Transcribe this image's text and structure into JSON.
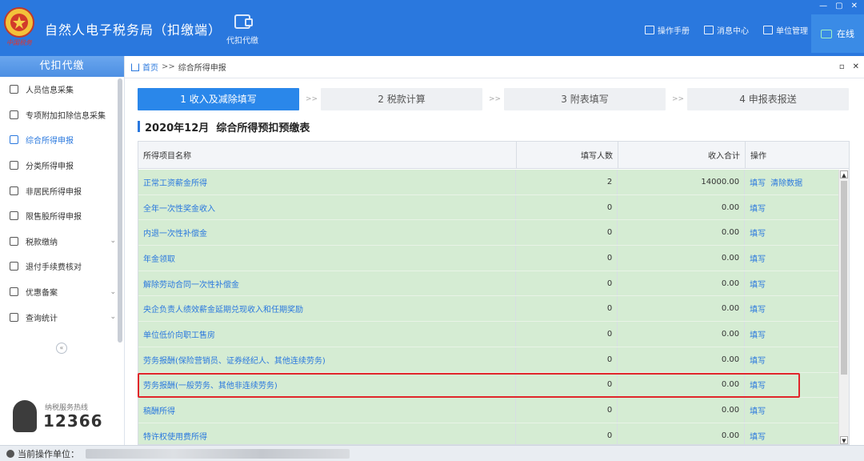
{
  "app": {
    "title": "自然人电子税务局（扣缴端）",
    "logo_text": "中国税务",
    "module_label": "代扣代缴"
  },
  "header": {
    "links": [
      "操作手册",
      "消息中心",
      "单位管理"
    ],
    "status": "在线",
    "window_controls": [
      "—",
      "▢",
      "✕"
    ]
  },
  "sidebar": {
    "title": "代扣代缴",
    "items": [
      {
        "label": "人员信息采集",
        "icon": "person-icon",
        "active": false,
        "expandable": false
      },
      {
        "label": "专项附加扣除信息采集",
        "icon": "list-icon",
        "active": false,
        "expandable": false
      },
      {
        "label": "综合所得申报",
        "icon": "layers-icon",
        "active": true,
        "expandable": false
      },
      {
        "label": "分类所得申报",
        "icon": "pie-chart-icon",
        "active": false,
        "expandable": false
      },
      {
        "label": "非居民所得申报",
        "icon": "person-outline-icon",
        "active": false,
        "expandable": false
      },
      {
        "label": "限售股所得申报",
        "icon": "bar-chart-icon",
        "active": false,
        "expandable": false
      },
      {
        "label": "税款缴纳",
        "icon": "folder-icon",
        "active": false,
        "expandable": true
      },
      {
        "label": "退付手续费核对",
        "icon": "document-icon",
        "active": false,
        "expandable": false
      },
      {
        "label": "优惠备案",
        "icon": "file-icon",
        "active": false,
        "expandable": true
      },
      {
        "label": "查询统计",
        "icon": "search-list-icon",
        "active": false,
        "expandable": true
      }
    ],
    "hotline_label": "纳税服务热线",
    "hotline_number": "12366"
  },
  "breadcrumb": {
    "home": "首页",
    "separator": ">>",
    "current": "综合所得申报"
  },
  "steps": [
    {
      "label": "1 收入及减除填写",
      "active": true
    },
    {
      "label": "2 税款计算",
      "active": false
    },
    {
      "label": "3 附表填写",
      "active": false
    },
    {
      "label": "4 申报表报送",
      "active": false
    }
  ],
  "step_separator": ">>",
  "table": {
    "title": "2020年12月  综合所得预扣预缴表",
    "columns": [
      "所得项目名称",
      "填写人数",
      "收入合计",
      "操作"
    ],
    "rows": [
      {
        "name": "正常工资薪金所得",
        "count": "2",
        "total": "14000.00",
        "actions": [
          "填写",
          "清除数据"
        ]
      },
      {
        "name": "全年一次性奖金收入",
        "count": "0",
        "total": "0.00",
        "actions": [
          "填写"
        ]
      },
      {
        "name": "内退一次性补偿金",
        "count": "0",
        "total": "0.00",
        "actions": [
          "填写"
        ]
      },
      {
        "name": "年金领取",
        "count": "0",
        "total": "0.00",
        "actions": [
          "填写"
        ]
      },
      {
        "name": "解除劳动合同一次性补偿金",
        "count": "0",
        "total": "0.00",
        "actions": [
          "填写"
        ]
      },
      {
        "name": "央企负责人绩效薪金延期兑现收入和任期奖励",
        "count": "0",
        "total": "0.00",
        "actions": [
          "填写"
        ]
      },
      {
        "name": "单位低价向职工售房",
        "count": "0",
        "total": "0.00",
        "actions": [
          "填写"
        ]
      },
      {
        "name": "劳务报酬(保险营销员、证券经纪人、其他连续劳务)",
        "count": "0",
        "total": "0.00",
        "actions": [
          "填写"
        ]
      },
      {
        "name": "劳务报酬(一般劳务、其他非连续劳务)",
        "count": "0",
        "total": "0.00",
        "actions": [
          "填写"
        ],
        "highlighted": true
      },
      {
        "name": "稿酬所得",
        "count": "0",
        "total": "0.00",
        "actions": [
          "填写"
        ]
      },
      {
        "name": "特许权使用费所得",
        "count": "0",
        "total": "0.00",
        "actions": [
          "填写"
        ]
      }
    ]
  },
  "statusbar": {
    "label": "当前操作单位："
  },
  "colors": {
    "header_blue": "#2a78de",
    "row_green": "#d5ecd3",
    "highlight_red": "#e0262b",
    "link_blue": "#2a78de"
  }
}
